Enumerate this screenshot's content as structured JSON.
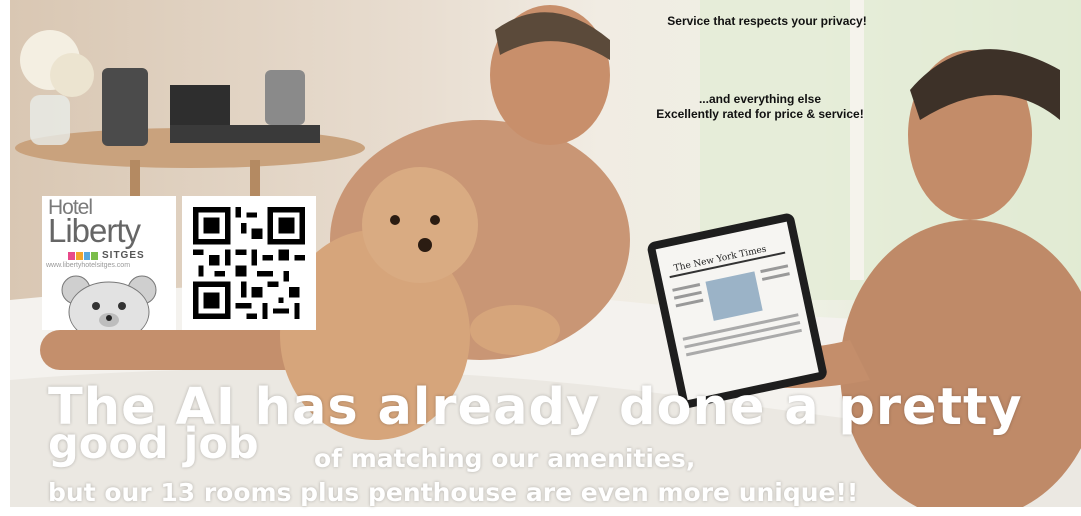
{
  "captions": {
    "privacy": "Service that respects your privacy!",
    "else_line": "...and everything else",
    "rated_line": "Excellently rated for price & service!"
  },
  "logo": {
    "hotel": "Hotel",
    "liberty": "Liberty",
    "sitges": "SITGES",
    "url": "www.libertyhotelsitges.com"
  },
  "qr": {
    "icon": "qr-code-icon"
  },
  "headline": {
    "line1": "The AI has already done a pretty",
    "line2": "good job",
    "line2_rest": "of matching our amenities,",
    "line3": "but our 13 rooms plus penthouse are even more unique!!"
  },
  "tablet": {
    "masthead": "The New York Times"
  },
  "colors": {
    "headline_text": "#ffffff",
    "caption_text": "#111111",
    "bed_white": "#f4f2ee",
    "skin": "#c99675",
    "dog": "#d6a57b"
  }
}
